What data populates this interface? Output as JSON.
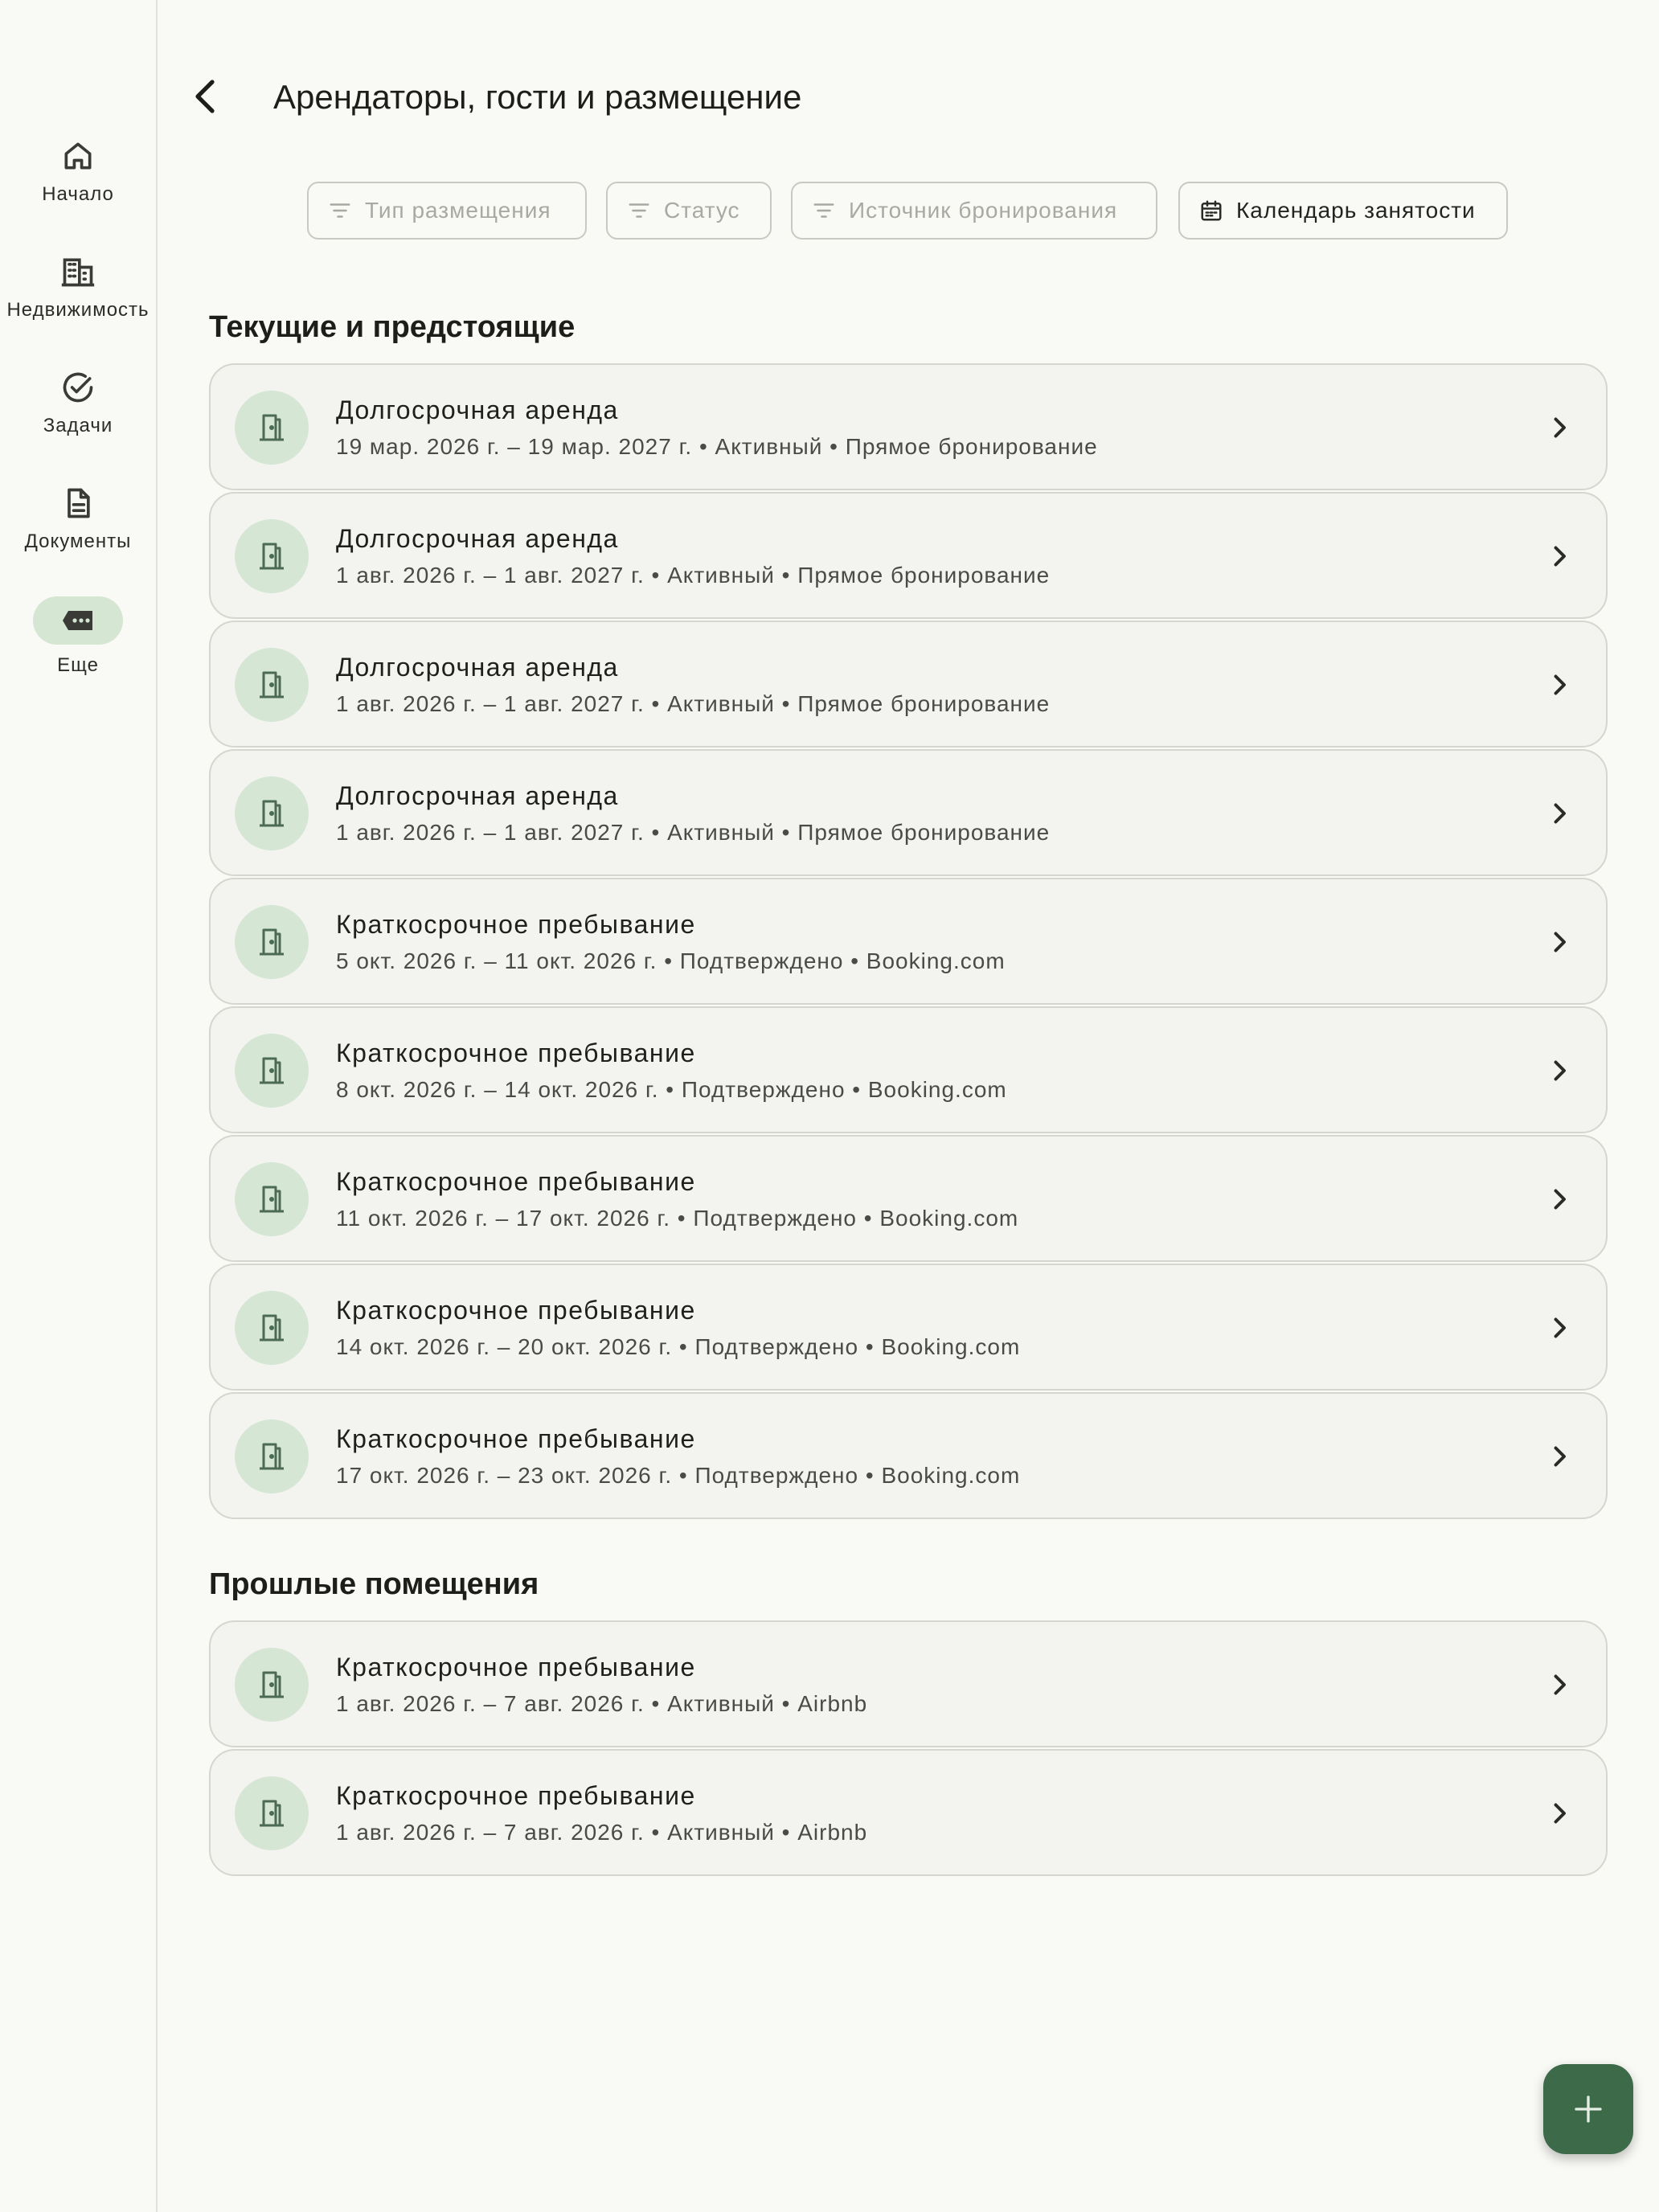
{
  "sidebar": {
    "items": [
      {
        "label": "Начало",
        "icon": "home-icon"
      },
      {
        "label": "Недвижимость",
        "icon": "building-icon"
      },
      {
        "label": "Задачи",
        "icon": "check-circle-icon"
      },
      {
        "label": "Документы",
        "icon": "document-icon"
      },
      {
        "label": "Еще",
        "icon": "more-icon",
        "selected": true
      }
    ]
  },
  "header": {
    "title": "Арендаторы, гости и размещение"
  },
  "filters": {
    "type": "Тип размещения",
    "status": "Статус",
    "source": "Источник бронирования",
    "calendar": "Календарь занятости"
  },
  "sections": {
    "current": {
      "heading": "Текущие и предстоящие",
      "items": [
        {
          "title": "Долгосрочная аренда",
          "subtitle": "19 мар. 2026 г. – 19 мар. 2027 г. • Активный • Прямое бронирование"
        },
        {
          "title": "Долгосрочная аренда",
          "subtitle": "1 авг. 2026 г. – 1 авг. 2027 г. • Активный • Прямое бронирование"
        },
        {
          "title": "Долгосрочная аренда",
          "subtitle": "1 авг. 2026 г. – 1 авг. 2027 г. • Активный • Прямое бронирование"
        },
        {
          "title": "Долгосрочная аренда",
          "subtitle": "1 авг. 2026 г. – 1 авг. 2027 г. • Активный • Прямое бронирование"
        },
        {
          "title": "Краткосрочное пребывание",
          "subtitle": "5 окт. 2026 г. – 11 окт. 2026 г. • Подтверждено • Booking.com"
        },
        {
          "title": "Краткосрочное пребывание",
          "subtitle": "8 окт. 2026 г. – 14 окт. 2026 г. • Подтверждено • Booking.com"
        },
        {
          "title": "Краткосрочное пребывание",
          "subtitle": "11 окт. 2026 г. – 17 окт. 2026 г. • Подтверждено • Booking.com"
        },
        {
          "title": "Краткосрочное пребывание",
          "subtitle": "14 окт. 2026 г. – 20 окт. 2026 г. • Подтверждено • Booking.com"
        },
        {
          "title": "Краткосрочное пребывание",
          "subtitle": "17 окт. 2026 г. – 23 окт. 2026 г. • Подтверждено • Booking.com"
        }
      ]
    },
    "past": {
      "heading": "Прошлые помещения",
      "items": [
        {
          "title": "Краткосрочное пребывание",
          "subtitle": "1 авг. 2026 г. – 7 авг. 2026 г. • Активный • Airbnb"
        },
        {
          "title": "Краткосрочное пребывание",
          "subtitle": "1 авг. 2026 г. – 7 авг. 2026 г. • Активный • Airbnb"
        }
      ]
    }
  },
  "fab": {
    "icon": "plus-icon"
  },
  "colors": {
    "background": "#f9f9f5",
    "card": "#f3f3ef",
    "accent": "#3d6b4a",
    "avatar": "#d6e6d4",
    "selected_pill": "#d5e6d3"
  }
}
